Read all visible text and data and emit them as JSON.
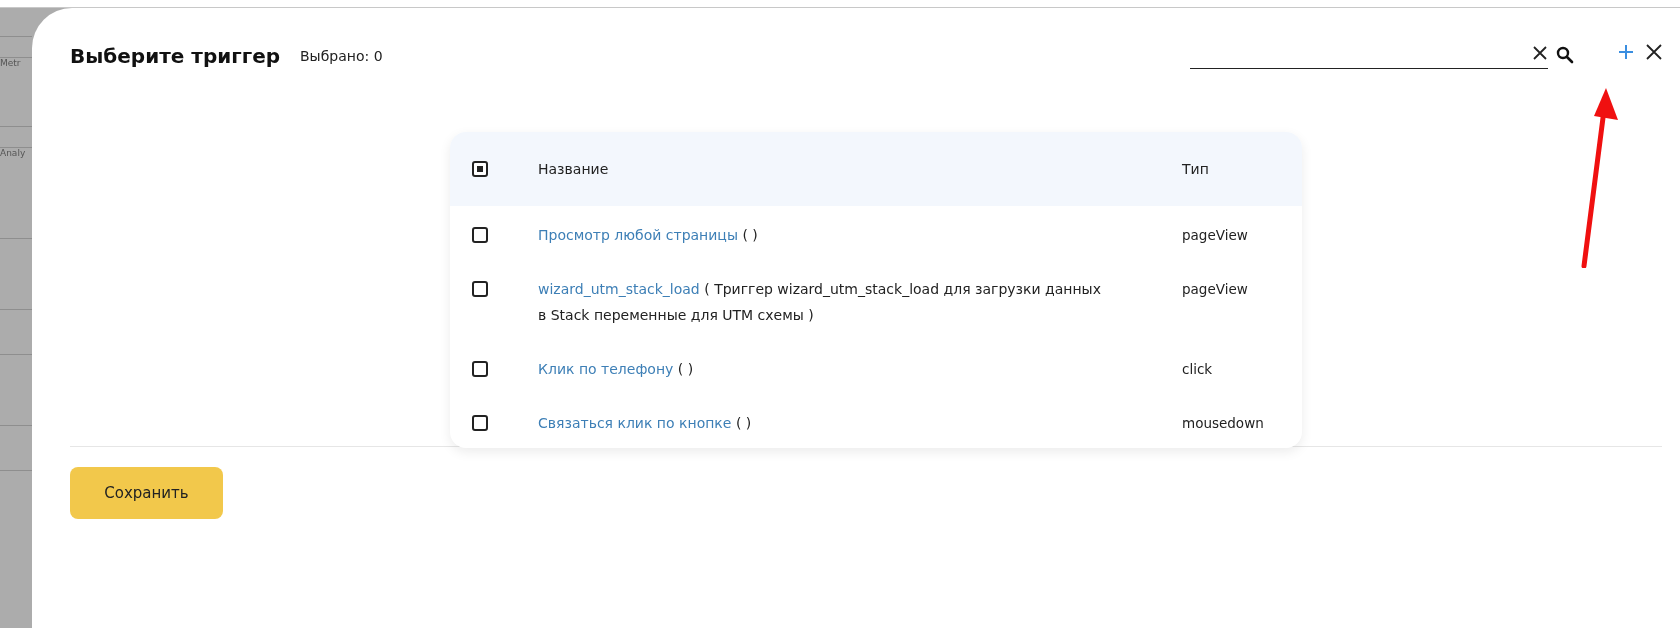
{
  "background_sidebar": {
    "items": [
      "Metr",
      "Analy"
    ]
  },
  "modal": {
    "title": "Выберите триггер",
    "selected_count": "Выбрано: 0"
  },
  "table": {
    "columns": [
      "Название",
      "Тип"
    ],
    "select_all": {
      "indeterminate": true
    },
    "rows": [
      {
        "checked": false,
        "name": "Просмотр любой страницы",
        "description": "( )",
        "type": "pageView"
      },
      {
        "checked": false,
        "name": "wizard_utm_stack_load",
        "description": "( Триггер wizard_utm_stack_load для загрузки данных в Stack переменные для UTM схемы )",
        "type": "pageView"
      },
      {
        "checked": false,
        "name": "Клик по телефону",
        "description": "( )",
        "type": "click"
      },
      {
        "checked": false,
        "name": "Связаться клик по кнопке",
        "description": "( )",
        "type": "mousedown"
      }
    ]
  },
  "save_button": "Сохранить"
}
